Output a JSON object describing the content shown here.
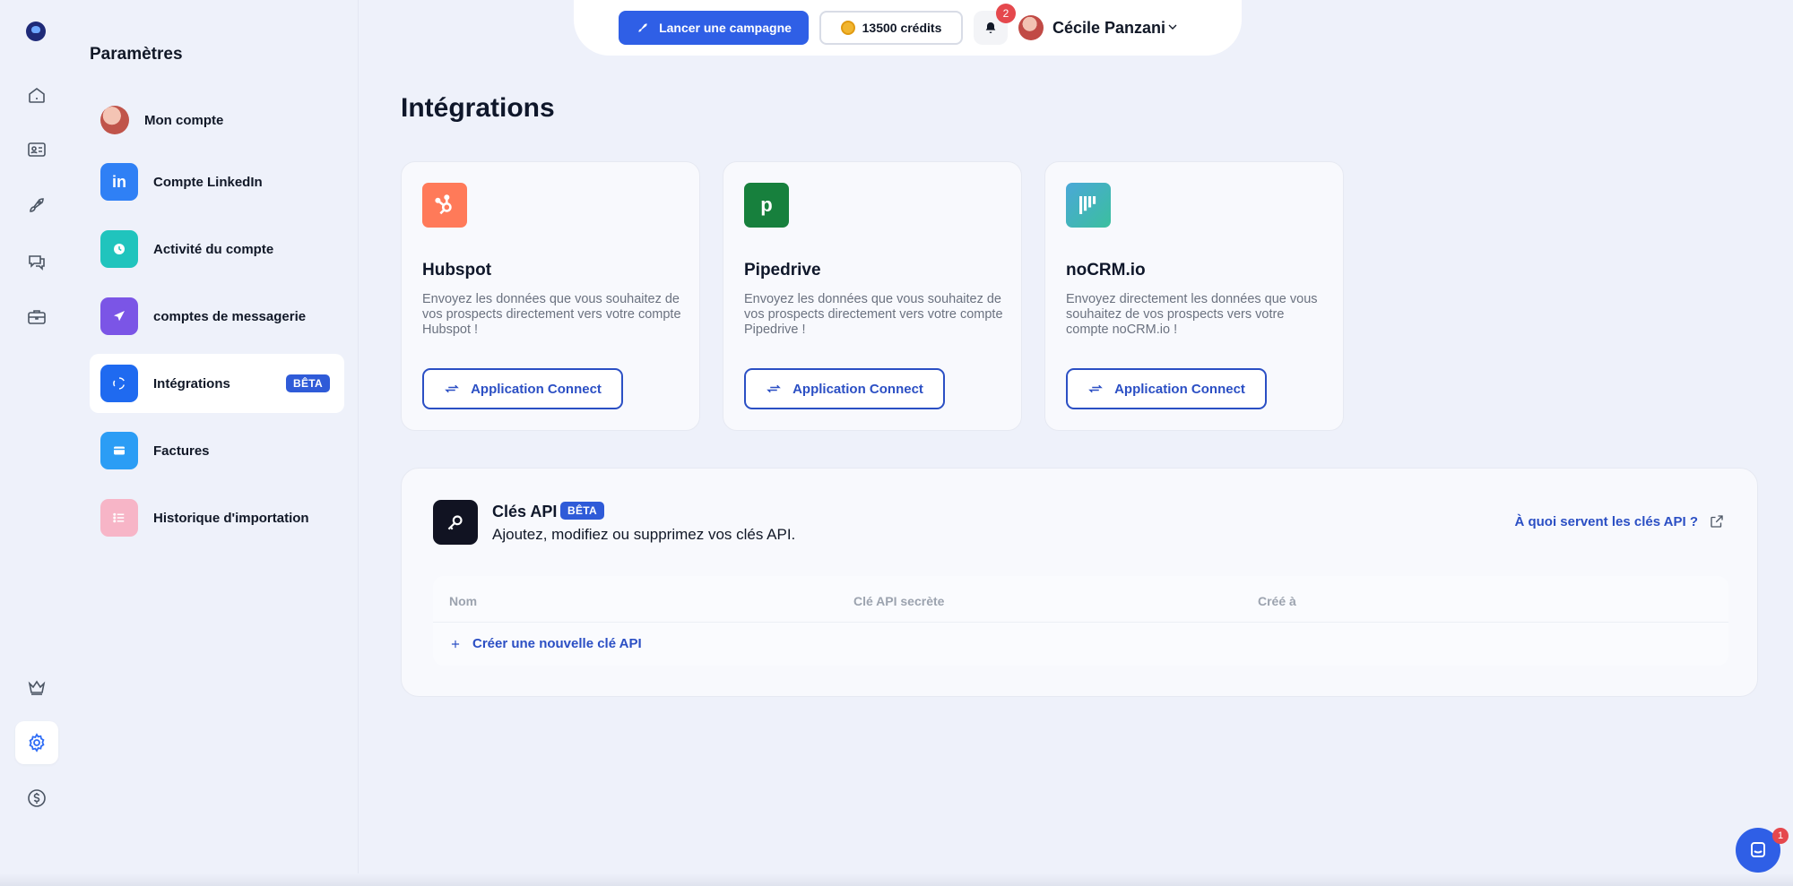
{
  "rail": {
    "items": [
      {
        "name": "home-icon"
      },
      {
        "name": "contacts-icon"
      },
      {
        "name": "rocket-icon"
      },
      {
        "name": "messages-icon"
      },
      {
        "name": "briefcase-icon"
      },
      {
        "name": "crown-icon"
      },
      {
        "name": "settings-icon",
        "active": true
      },
      {
        "name": "dollar-icon"
      }
    ]
  },
  "settings": {
    "title": "Paramètres",
    "items": [
      {
        "label": "Mon compte",
        "icon": "avatar"
      },
      {
        "label": "Compte LinkedIn",
        "icon": "linkedin-icon",
        "color": "#2f80f5"
      },
      {
        "label": "Activité du compte",
        "icon": "clock-icon",
        "color": "#20c4bd"
      },
      {
        "label": "comptes de messagerie",
        "icon": "send-icon",
        "color": "#7b55e6"
      },
      {
        "label": "Intégrations",
        "icon": "integrations-icon",
        "color": "#1f6af0",
        "active": true,
        "badge": "BÊTA"
      },
      {
        "label": "Factures",
        "icon": "card-icon",
        "color": "#2b9df5"
      },
      {
        "label": "Historique d'importation",
        "icon": "list-icon",
        "color": "#f7b5c7"
      }
    ]
  },
  "topbar": {
    "campaign_label": "Lancer une campagne",
    "credits_label": "13500 crédits",
    "notifications_count": "2",
    "user_name": "Cécile Panzani"
  },
  "main": {
    "title": "Intégrations",
    "cards": [
      {
        "name": "Hubspot",
        "description": "Envoyez les données que vous souhaitez de vos prospects directement vers votre compte Hubspot !",
        "button": "Application Connect",
        "logo_color": "#ff7a59"
      },
      {
        "name": "Pipedrive",
        "description": "Envoyez les données que vous souhaitez de vos prospects directement vers votre compte Pipedrive !",
        "button": "Application Connect",
        "logo_color": "#17803d"
      },
      {
        "name": "noCRM.io",
        "description": "Envoyez directement les données que vous souhaitez de vos prospects vers votre compte noCRM.io !",
        "button": "Application Connect",
        "logo_color": "#3aa6b9"
      }
    ]
  },
  "api": {
    "title": "Clés API",
    "badge": "BÊTA",
    "subtitle": "Ajoutez, modifiez ou supprimez vos clés API.",
    "help_link": "À quoi servent les clés API ?",
    "columns": [
      "Nom",
      "Clé API secrète",
      "Créé à"
    ],
    "create_label": "Créer une nouvelle clé API"
  },
  "chat": {
    "badge": "1"
  }
}
